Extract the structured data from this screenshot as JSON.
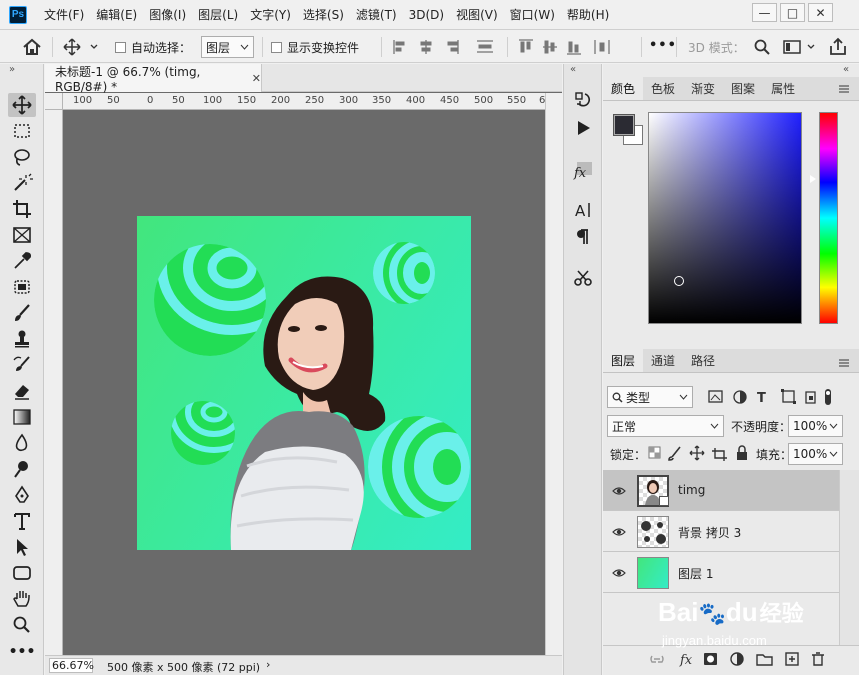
{
  "app": {
    "logo_text": "Ps",
    "menu": [
      "文件(F)",
      "编辑(E)",
      "图像(I)",
      "图层(L)",
      "文字(Y)",
      "选择(S)",
      "滤镜(T)",
      "3D(D)",
      "视图(V)",
      "窗口(W)",
      "帮助(H)"
    ],
    "window_buttons": {
      "minimize": "—",
      "restore": "□",
      "close": "✕"
    }
  },
  "options": {
    "auto_select_label": "自动选择：",
    "auto_select_target": "图层",
    "show_transform_label": "显示变换控件",
    "more": "•••",
    "mode_3d_label": "3D 模式："
  },
  "document": {
    "tab_title": "未标题-1 @ 66.7% (timg, RGB/8#) *",
    "ruler_ticks": [
      "100",
      "50",
      "0",
      "50",
      "100",
      "150",
      "200",
      "250",
      "300",
      "350",
      "400",
      "450",
      "500",
      "550",
      "6"
    ],
    "zoom": "66.67%",
    "doc_info": "500 像素 x 500 像素 (72 ppi)",
    "status_arrow": "›"
  },
  "panels": {
    "color_tabs": [
      "颜色",
      "色板",
      "渐变",
      "图案",
      "属性"
    ],
    "layers_tabs": [
      "图层",
      "通道",
      "路径"
    ],
    "filter_kind": "类型",
    "blend_mode": "正常",
    "opacity_label": "不透明度：",
    "opacity_value": "100%",
    "lock_label": "锁定：",
    "fill_label": "填充：",
    "fill_value": "100%",
    "layers": [
      {
        "name": "timg",
        "selected": true
      },
      {
        "name": "背景 拷贝 3",
        "selected": false
      },
      {
        "name": "图层 1",
        "selected": false
      }
    ],
    "foreground_color": "#2b2b33",
    "background_color": "#ffffff",
    "picker_hue_color": "#2020ff"
  },
  "watermark": {
    "brand": "Bai",
    "brand_tail": "du",
    "product": "经验",
    "url": "jingyan.baidu.com"
  },
  "colors": {
    "canvas_start": "#42e67d",
    "canvas_end": "#34ecc6",
    "ball_green": "#22dd55",
    "ball_cyan": "#6af0ea"
  }
}
